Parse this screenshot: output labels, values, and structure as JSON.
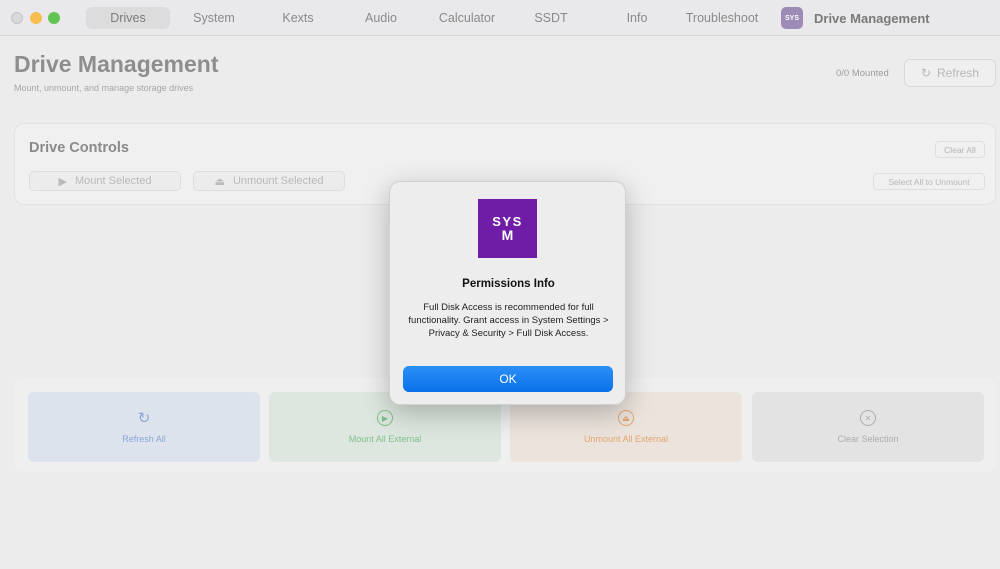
{
  "window": {
    "app_title": "Drive Management",
    "tabs": [
      {
        "label": "Drives",
        "active": true
      },
      {
        "label": "System",
        "active": false
      },
      {
        "label": "Kexts",
        "active": false
      },
      {
        "label": "Audio",
        "active": false
      },
      {
        "label": "Calculator",
        "active": false
      },
      {
        "label": "SSDT",
        "active": false
      },
      {
        "label": "Info",
        "active": false
      },
      {
        "label": "Troubleshoot",
        "active": false
      }
    ]
  },
  "header": {
    "title": "Drive Management",
    "subtitle": "Mount, unmount, and manage storage drives",
    "mounted_count": "0/0 Mounted",
    "refresh_label": "Refresh"
  },
  "controls": {
    "title": "Drive Controls",
    "clear_all_label": "Clear All",
    "mount_selected_label": "Mount Selected",
    "unmount_selected_label": "Unmount Selected",
    "select_all_unmount_label": "Select All to Unmount"
  },
  "actions": {
    "refresh_all": "Refresh All",
    "mount_all_external": "Mount All External",
    "unmount_all_external": "Unmount All External",
    "clear_selection": "Clear Selection"
  },
  "dialog": {
    "logo_text": "SYS",
    "title": "Permissions Info",
    "message": "Full Disk Access is recommended for full functionality. Grant access in System Settings > Privacy & Security > Full Disk Access.",
    "ok_label": "OK",
    "accent": "#6f1ca7",
    "button_color": "#0a72ea"
  }
}
